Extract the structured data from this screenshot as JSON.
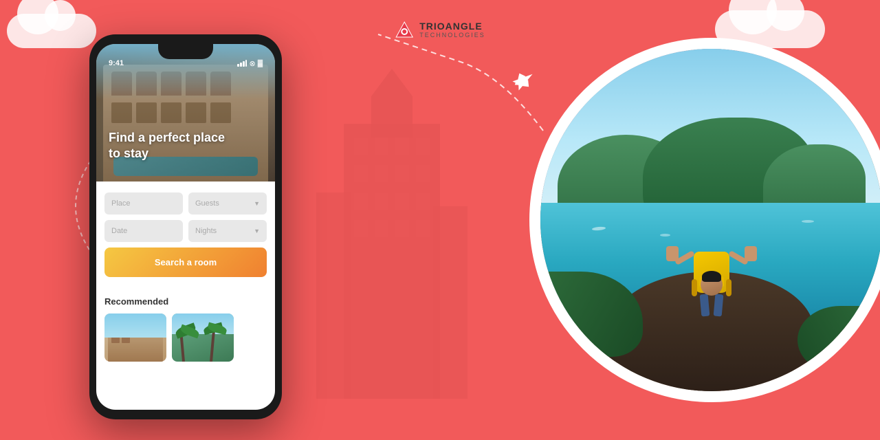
{
  "background_color": "#F25A5A",
  "logo": {
    "name": "TRIOANGLE",
    "subtitle": "TECHNOLOGIES"
  },
  "hero": {
    "title_line1": "Find a perfect place",
    "title_line2": "to stay"
  },
  "form": {
    "place_placeholder": "Place",
    "guests_placeholder": "Guests",
    "date_placeholder": "Date",
    "nights_placeholder": "Nights",
    "search_button": "Search a room"
  },
  "recommended": {
    "section_title": "Recommended"
  },
  "status_bar": {
    "time": "9:41"
  },
  "clouds": [
    {
      "id": "top-left"
    },
    {
      "id": "top-right"
    }
  ],
  "accent_color": "#F5C842",
  "gradient_button": "#F08030"
}
